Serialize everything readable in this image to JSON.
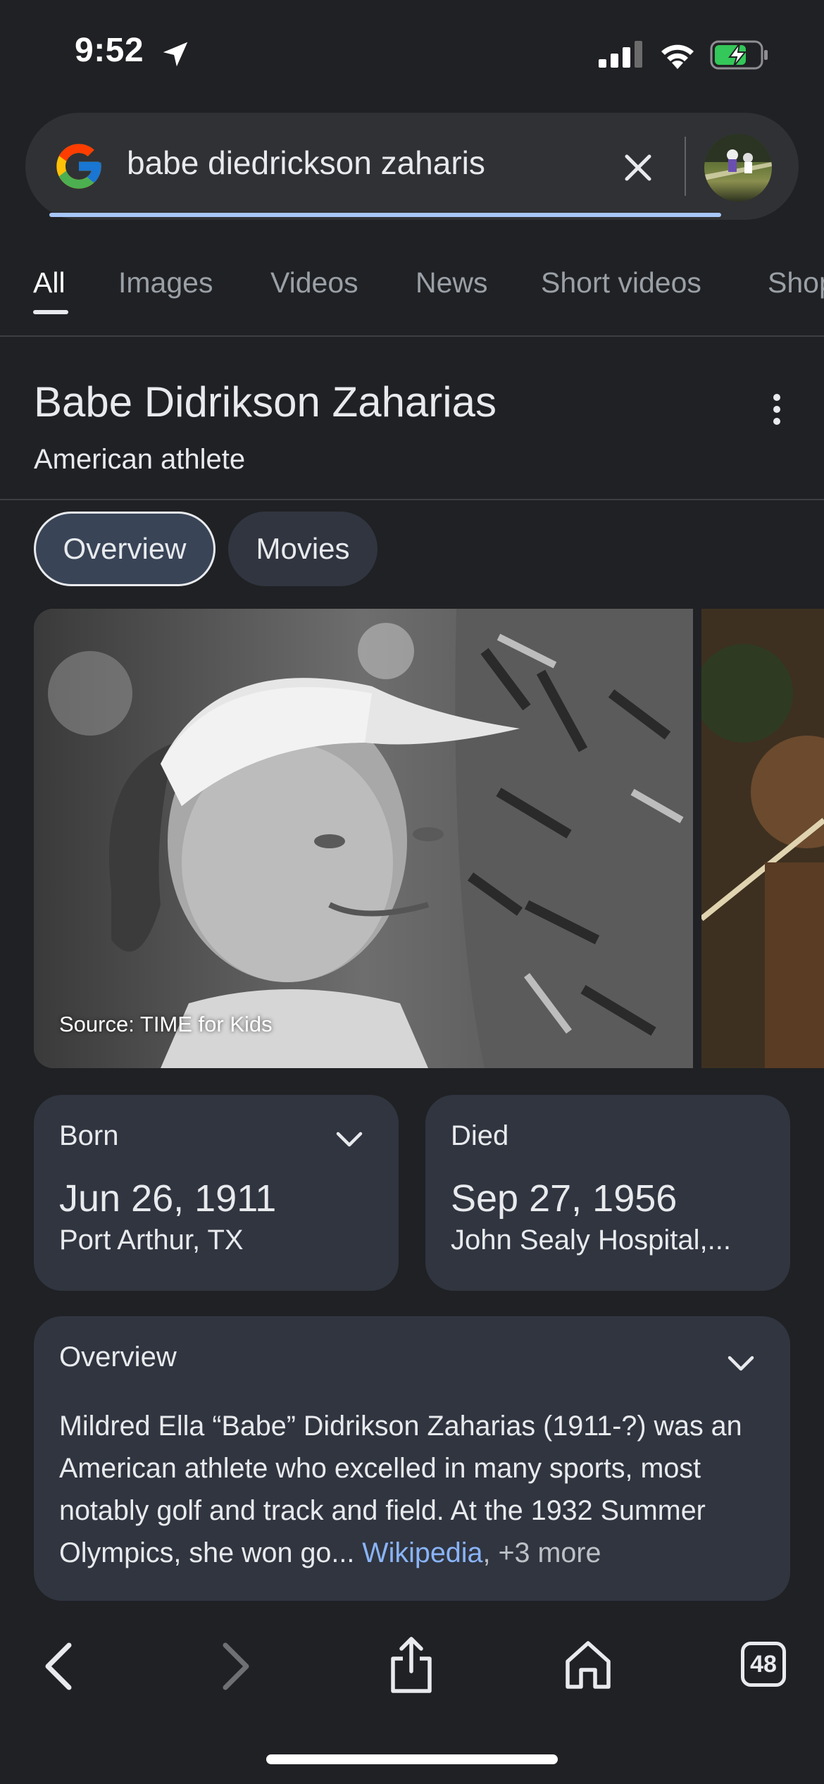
{
  "status_bar": {
    "time": "9:52",
    "icons": [
      "location-arrow-icon",
      "cellular-signal-icon",
      "wifi-icon",
      "battery-charging-icon"
    ]
  },
  "search": {
    "query": "babe diedrickson zaharis",
    "icons": [
      "google-logo-icon",
      "clear-icon",
      "google-lens-avatar"
    ]
  },
  "tabs": [
    "All",
    "Images",
    "Videos",
    "News",
    "Short videos",
    "Shop"
  ],
  "active_tab": "All",
  "knowledge_panel": {
    "title": "Babe Didrikson Zaharias",
    "subtitle": "American athlete",
    "chips": [
      "Overview",
      "Movies"
    ],
    "active_chip": "Overview",
    "image_source": "Source: TIME for Kids",
    "born": {
      "label": "Born",
      "value": "Jun 26, 1911",
      "place": "Port Arthur, TX"
    },
    "died": {
      "label": "Died",
      "value": "Sep 27, 1956",
      "place": "John Sealy Hospital,..."
    },
    "overview": {
      "label": "Overview",
      "text": "Mildred Ella “Babe” Didrikson Zaharias (1911-?) was an American athlete who excelled in many sports, most notably golf and track and field. At the 1932 Summer Olympics, she won go... ",
      "source_link": "Wikipedia",
      "more": ", +3 more"
    }
  },
  "toolbar": {
    "tab_count": "48",
    "icons": [
      "back-icon",
      "forward-icon",
      "share-icon",
      "home-icon",
      "tabs-icon"
    ]
  },
  "colors": {
    "background": "#202124",
    "card": "#303540",
    "link": "#8ab4f8",
    "progress": "#a8c7fa",
    "battery": "#34c759"
  }
}
